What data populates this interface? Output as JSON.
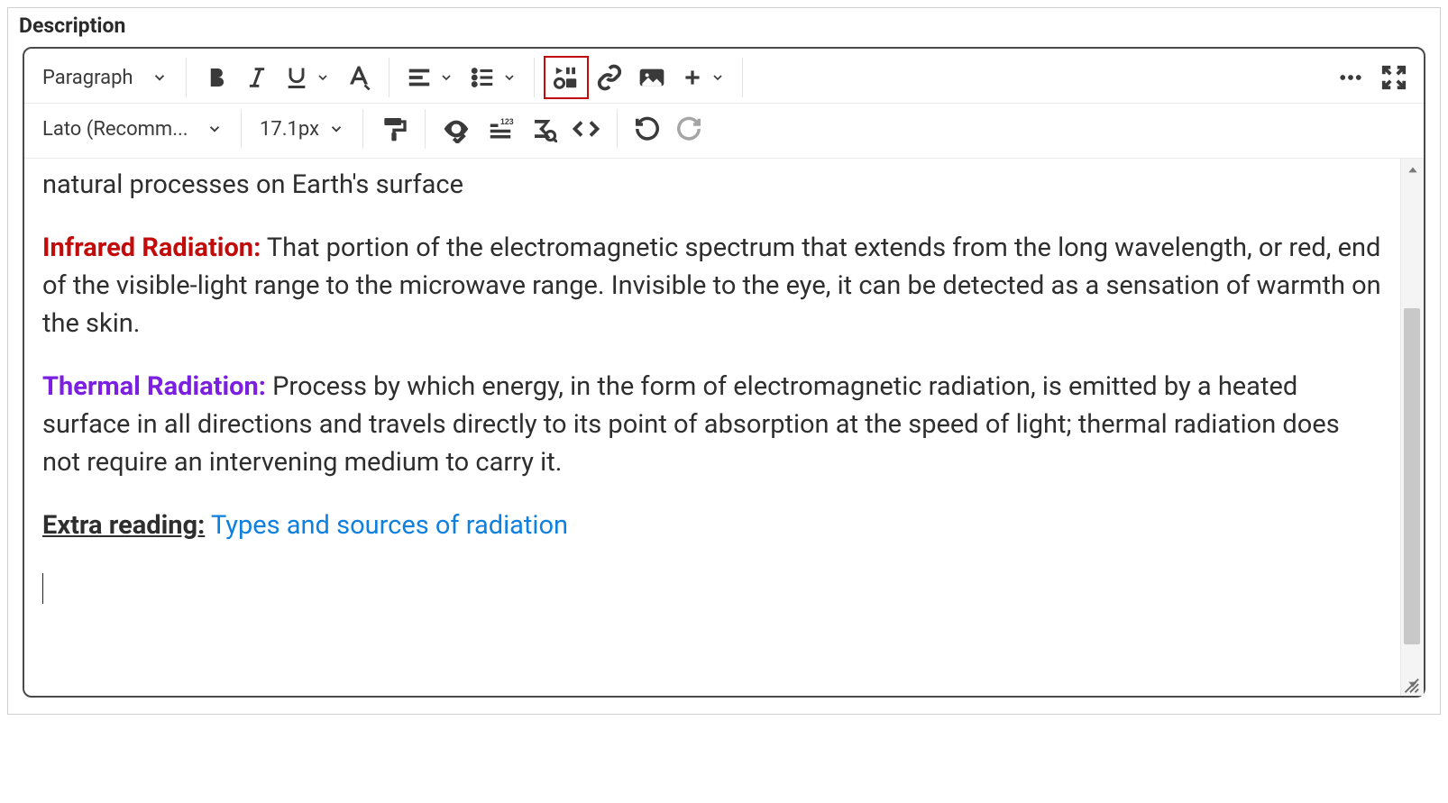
{
  "label": "Description",
  "toolbar": {
    "block": "Paragraph",
    "font": "Lato (Recomm...",
    "size": "17.1px"
  },
  "content": {
    "intro": "natural processes on Earth's surface",
    "infrared": {
      "term": "Infrared Radiation:",
      "text": " That portion of the electromagnetic spectrum that extends from the long wavelength, or red, end of the visible-light range to the microwave range. Invisible to the eye, it can be detected as a sensation of warmth on the skin."
    },
    "thermal": {
      "term": "Thermal Radiation:",
      "text": " Process by which energy, in the form of electromagnetic radiation, is emitted by a heated surface in all directions and travels directly to its point of absorption at the speed of light; thermal radiation does not require an intervening medium to carry it."
    },
    "extra": {
      "label": "Extra reading:",
      "link": "Types and sources of radiation"
    }
  }
}
